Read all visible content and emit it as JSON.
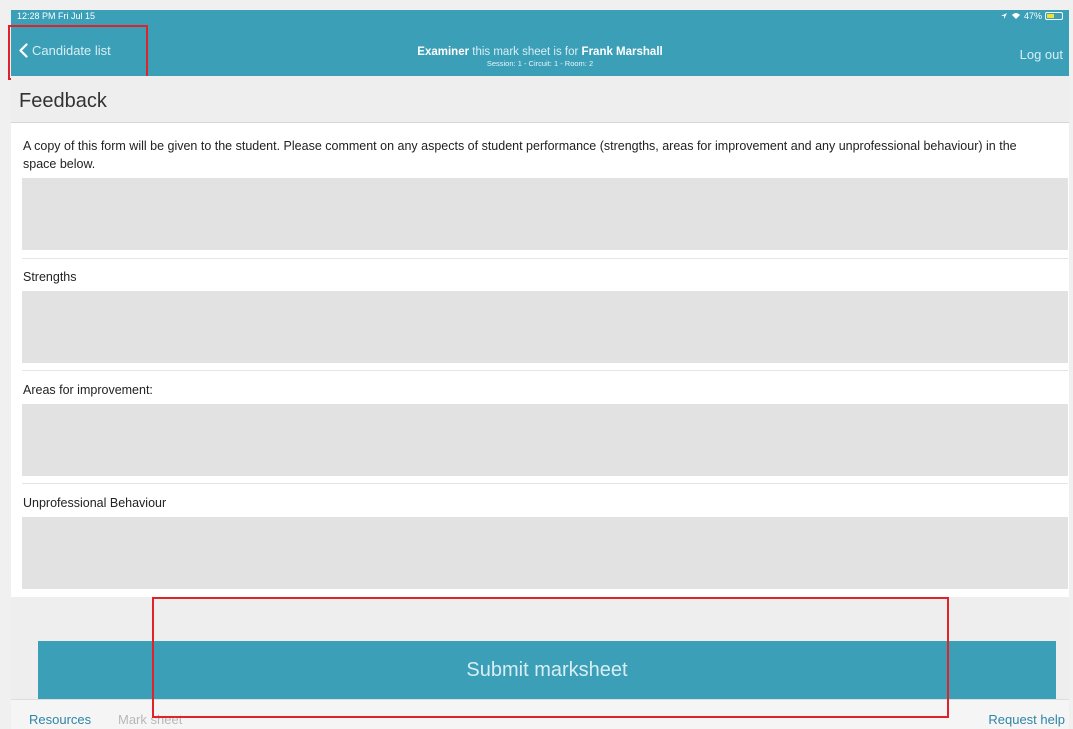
{
  "status_bar": {
    "time": "12:28 PM  Fri Jul 15",
    "battery": "47%",
    "icons": [
      "location-icon",
      "wifi-icon",
      "battery-charging-icon"
    ]
  },
  "nav": {
    "back_label": "Candidate list",
    "title_role": "Examiner",
    "title_middle": " this mark sheet is for ",
    "title_name": "Frank Marshall",
    "subtitle": "Session: 1  -  Circuit: 1  -  Room: 2",
    "logout_label": "Log out",
    "back_icon": "chevron-left-icon"
  },
  "feedback": {
    "header": "Feedback",
    "intro": "A copy of this form will be given to the student. Please comment on any aspects of student performance (strengths, areas for improvement and any unprofessional behaviour) in the space below.",
    "general_value": "",
    "strengths_label": "Strengths",
    "strengths_value": "",
    "improvement_label": "Areas for improvement:",
    "improvement_value": "",
    "unprofessional_label": "Unprofessional Behaviour",
    "unprofessional_value": ""
  },
  "submit_label": "Submit marksheet",
  "tabs": {
    "resources": "Resources",
    "mark_sheet": "Mark sheet",
    "request_help": "Request help"
  },
  "colors": {
    "accent": "#3b9fb8",
    "highlight": "#e0232b",
    "field_bg": "#e2e2e2",
    "link": "#2d86a6"
  }
}
